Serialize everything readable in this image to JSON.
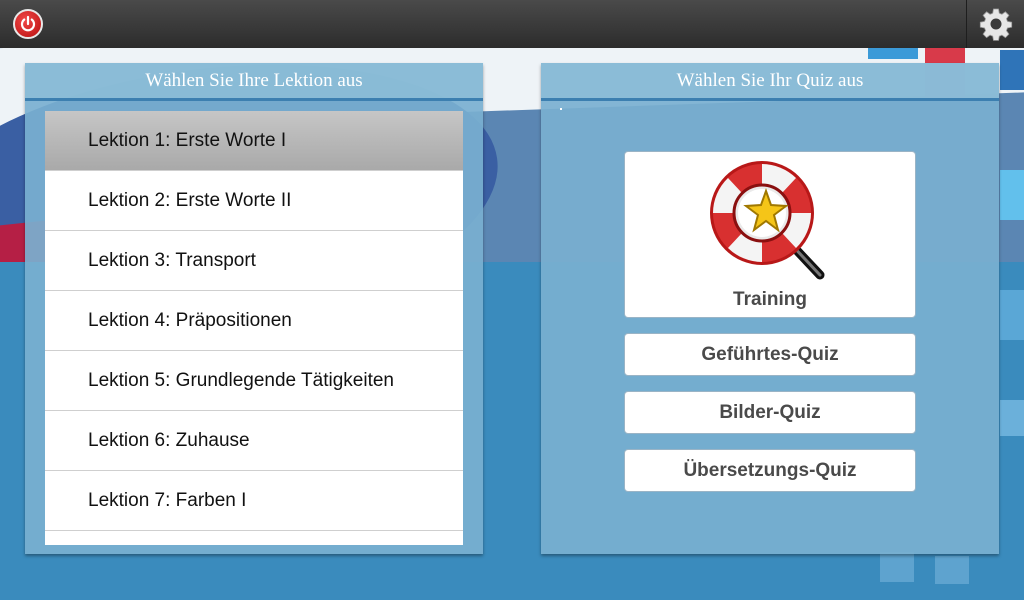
{
  "topbar": {
    "power_icon": "power-icon",
    "settings_icon": "gear-icon"
  },
  "lessons_panel": {
    "title": "Wählen Sie Ihre Lektion aus",
    "items": [
      "Lektion 1: Erste Worte I",
      "Lektion 2: Erste Worte II",
      "Lektion 3: Transport",
      "Lektion 4: Präpositionen",
      "Lektion 5: Grundlegende Tätigkeiten",
      "Lektion 6: Zuhause",
      "Lektion 7: Farben I"
    ],
    "selected_index": 0
  },
  "quiz_panel": {
    "title": "Wählen Sie Ihr Quiz aus",
    "training_label": "Training",
    "training_icon": "lifebuoy-magnifier-star-icon",
    "guided_label": "Geführtes-Quiz",
    "picture_label": "Bilder-Quiz",
    "translation_label": "Übersetzungs-Quiz"
  },
  "colors": {
    "topbar": "#333333",
    "panel": "#7ab0d0",
    "panel_border": "#3c7fb0",
    "selected_item": "#b5b5b5",
    "power_red": "#d42020",
    "background_blue": "#3a8bbd",
    "background_red": "#b51f45"
  }
}
